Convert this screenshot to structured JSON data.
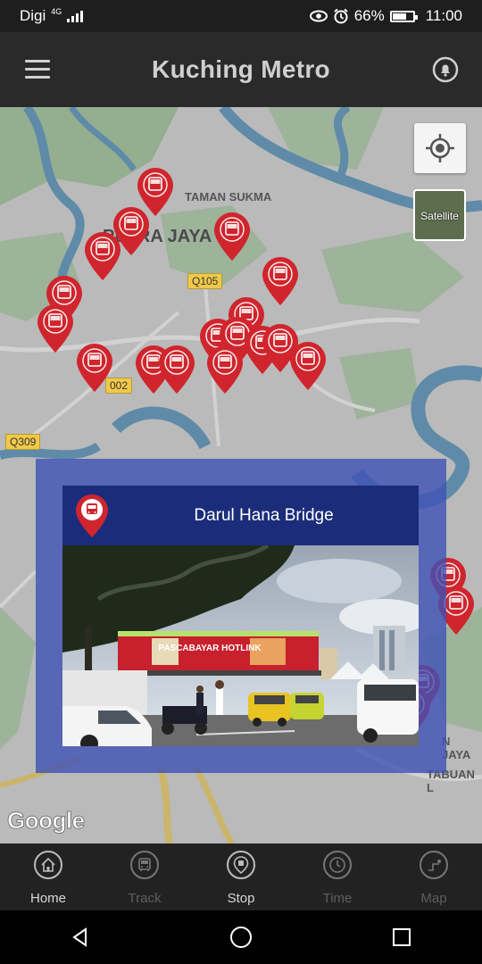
{
  "status_bar": {
    "carrier": "Digi",
    "network": "4G",
    "battery": "66%",
    "battery_level": 0.66,
    "time": "11:00",
    "icons": [
      "signal-icon",
      "eye-icon",
      "alarm-icon",
      "battery-icon"
    ]
  },
  "app_bar": {
    "title": "Kuching Metro",
    "menu_icon": "menu-icon",
    "bell_icon": "bell-icon"
  },
  "map": {
    "labels": {
      "taman_sukma": "TAMAN SUKMA",
      "petra_jaya": "PETRA JAYA",
      "jaya": "N JAYA",
      "tabuan": "TABUAN L"
    },
    "road_badges": {
      "q105": "Q105",
      "r002": "002",
      "q309": "Q309"
    },
    "satellite_label": "Satellite",
    "google": "Google",
    "pin_color": "#d0252d"
  },
  "popup": {
    "title": "Darul Hana Bridge",
    "photo_text": {
      "billboard_main": "PASCABAYAR HOTLINK",
      "billboard_side": "PASCABAYAR HOTLINK"
    }
  },
  "bottom_nav": {
    "items": [
      {
        "label": "Home",
        "icon": "home-icon",
        "active": true
      },
      {
        "label": "Track",
        "icon": "bus-icon",
        "active": false
      },
      {
        "label": "Stop",
        "icon": "stop-icon",
        "active": true
      },
      {
        "label": "Time",
        "icon": "clock-icon",
        "active": false
      },
      {
        "label": "Map",
        "icon": "route-icon",
        "active": false
      }
    ]
  },
  "colors": {
    "overlay": "#3f51b5",
    "header": "#1b2d7a",
    "pin": "#d0252d",
    "app_bar": "#2a2a2a"
  }
}
